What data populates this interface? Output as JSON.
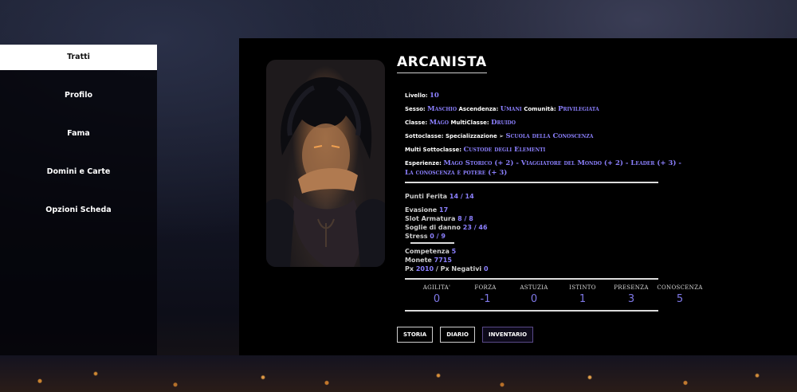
{
  "sidebar": {
    "items": [
      {
        "label": "Tratti",
        "active": true
      },
      {
        "label": "Profilo"
      },
      {
        "label": "Fama"
      },
      {
        "label": "Domini e Carte"
      },
      {
        "label": "Opzioni Scheda"
      }
    ]
  },
  "character": {
    "name": "ARCANISTA",
    "portrait_icon": "character-portrait",
    "details": {
      "livello_label": "Livello:",
      "livello": "10",
      "sesso_label": "Sesso:",
      "sesso": "Maschio",
      "ascendenza_label": "Ascendenza:",
      "ascendenza": "Umani",
      "comunita_label": "Comunità:",
      "comunita": "Privilegiata",
      "classe_label": "Classe:",
      "classe": "Mago",
      "multiclasse_label": "MultiClasse:",
      "multiclasse": "Druido",
      "sottoclasse_label": "Sottoclasse: Specializzazione",
      "sottoclasse_arrow": "➢",
      "sottoclasse": "Scuola della Conoscenza",
      "multi_sottoclasse_label": "Multi Sottoclasse:",
      "multi_sottoclasse": "Custode degli Elementi",
      "esperienze_label": "Esperienze:",
      "esperienze": "Mago Storico (+ 2) - Viaggiatore del Mondo (+ 2) - Leader (+ 3) - La conoscenza è potere (+ 3)"
    },
    "stats": {
      "punti_ferita_label": "Punti Ferita",
      "punti_ferita": "14",
      "punti_ferita_max": "14",
      "evasione_label": "Evasione",
      "evasione": "17",
      "slot_armatura_label": "Slot Armatura",
      "slot_armatura": "8",
      "slot_armatura_max": "8",
      "soglie_label": "Soglie di danno",
      "soglia_1": "23",
      "soglia_2": "46",
      "stress_label": "Stress",
      "stress": "0",
      "stress_max": "9",
      "competenza_label": "Competenza",
      "competenza": "5",
      "monete_label": "Monete",
      "monete": "7715",
      "px_label": "Px",
      "px": "2010",
      "px_negativi_label": "/ Px Negativi",
      "px_negativi": "0",
      "slash": "/"
    },
    "attributes": [
      {
        "label": "AGILITA'",
        "value": "0"
      },
      {
        "label": "FORZA",
        "value": "-1"
      },
      {
        "label": "ASTUZIA",
        "value": "0"
      },
      {
        "label": "ISTINTO",
        "value": "1"
      },
      {
        "label": "PRESENZA",
        "value": "3"
      },
      {
        "label": "CONOSCENZA",
        "value": "5"
      }
    ],
    "tabs": [
      {
        "label": "STORIA"
      },
      {
        "label": "DIARIO"
      },
      {
        "label": "INVENTARIO",
        "active": true
      }
    ]
  },
  "colors": {
    "accent": "#8c80ff",
    "panel_bg": "#000000",
    "active_nav_bg": "#ffffff"
  }
}
